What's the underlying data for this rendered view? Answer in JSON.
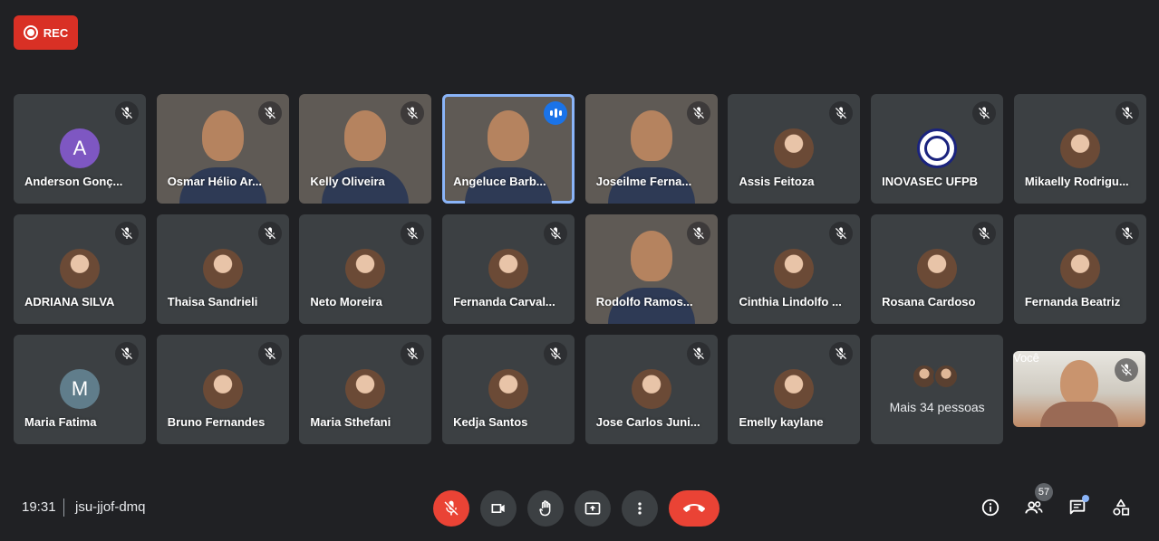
{
  "recording": {
    "label": "REC"
  },
  "tiles": [
    {
      "name": "Anderson Gonç...",
      "kind": "initial",
      "initial": "A",
      "color": "#7e57c2"
    },
    {
      "name": "Osmar Hélio Ar...",
      "kind": "video",
      "bg": "video-bg1"
    },
    {
      "name": "Kelly Oliveira",
      "kind": "video",
      "bg": "video-bg2"
    },
    {
      "name": "Angeluce Barb...",
      "kind": "video",
      "bg": "video-bg3",
      "speaking": true
    },
    {
      "name": "Joseilme Ferna...",
      "kind": "video",
      "bg": "video-bg4"
    },
    {
      "name": "Assis Feitoza",
      "kind": "photo"
    },
    {
      "name": "INOVASEC UFPB",
      "kind": "logo"
    },
    {
      "name": "Mikaelly Rodrigu...",
      "kind": "photo"
    },
    {
      "name": "ADRIANA SILVA",
      "kind": "photo"
    },
    {
      "name": "Thaisa Sandrieli",
      "kind": "photo"
    },
    {
      "name": "Neto Moreira",
      "kind": "photo"
    },
    {
      "name": "Fernanda Carval...",
      "kind": "photo"
    },
    {
      "name": "Rodolfo Ramos...",
      "kind": "video",
      "bg": "video-bg5"
    },
    {
      "name": "Cinthia Lindolfo ...",
      "kind": "photo"
    },
    {
      "name": "Rosana Cardoso",
      "kind": "photo"
    },
    {
      "name": "Fernanda Beatriz",
      "kind": "photo"
    },
    {
      "name": "Maria Fatima",
      "kind": "initial",
      "initial": "M",
      "color": "#607d8b"
    },
    {
      "name": "Bruno Fernandes",
      "kind": "photo"
    },
    {
      "name": "Maria Sthefani",
      "kind": "photo"
    },
    {
      "name": "Kedja Santos",
      "kind": "photo"
    },
    {
      "name": "Jose Carlos Juni...",
      "kind": "photo"
    },
    {
      "name": "Emelly kaylane",
      "kind": "photo"
    }
  ],
  "more": {
    "label": "Mais 34 pessoas"
  },
  "self": {
    "label": "Você"
  },
  "bottom": {
    "time": "19:31",
    "meeting_code": "jsu-jjof-dmq",
    "participants_count": "57"
  },
  "icons": {
    "mic": "mic-off-icon",
    "camera": "videocam-icon",
    "hand": "raise-hand-icon",
    "present": "present-screen-icon",
    "more": "more-vert-icon",
    "hangup": "call-end-icon",
    "info": "info-icon",
    "people": "people-icon",
    "chat": "chat-icon",
    "activities": "activities-icon"
  },
  "colors": {
    "background": "#202124",
    "tile": "#3c4043",
    "danger": "#ea4335",
    "accent": "#8ab4f8"
  }
}
